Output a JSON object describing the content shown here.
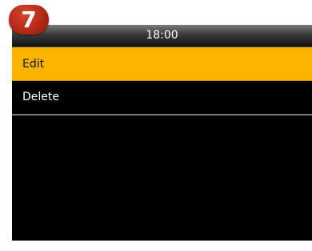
{
  "step_badge": "7",
  "status_bar": {
    "time": "18:00"
  },
  "menu": {
    "items": [
      {
        "label": "Edit",
        "selected": true
      },
      {
        "label": "Delete",
        "selected": false
      }
    ]
  },
  "colors": {
    "highlight": "#fcb300",
    "screen_background": "#000000",
    "badge": "#b32a18"
  }
}
